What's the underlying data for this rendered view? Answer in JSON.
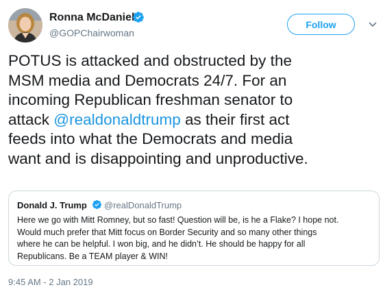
{
  "author": {
    "name": "Ronna McDaniel",
    "handle": "@GOPChairwoman",
    "verified": true
  },
  "actions": {
    "follow_label": "Follow"
  },
  "tweet": {
    "text_before": "POTUS is attacked and obstructed by the\nMSM media and Democrats 24/7. For an\nincoming Republican freshman senator to\nattack ",
    "mention": "@realdonaldtrump",
    "text_after": " as their first act\nfeeds into what the Democrats and media\nwant and is disappointing and unproductive.",
    "timestamp": "9:45 AM - 2 Jan 2019"
  },
  "quoted": {
    "name": "Donald J. Trump",
    "handle": "@realDonaldTrump",
    "verified": true,
    "text": "Here we go with Mitt Romney, but so fast! Question will be, is he a Flake?  I hope not.\nWould much prefer that Mitt focus on Border Security and so many other things\nwhere he can be helpful. I won big, and he didn’t. He should be happy for all\nRepublicans. Be a TEAM player & WIN!"
  },
  "colors": {
    "accent": "#1da1f2",
    "link": "#1b95e0",
    "secondary_text": "#657786",
    "border": "#ccd6dd"
  },
  "icons": {
    "verified": "verified-badge-icon",
    "menu": "chevron-down-icon"
  }
}
